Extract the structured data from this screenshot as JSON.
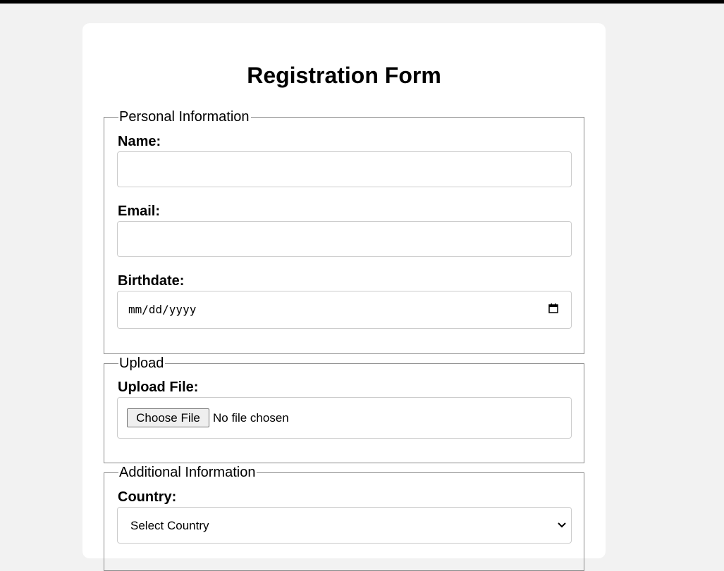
{
  "form": {
    "title": "Registration Form",
    "personal": {
      "legend": "Personal Information",
      "name_label": "Name:",
      "name_value": "",
      "email_label": "Email:",
      "email_value": "",
      "birthdate_label": "Birthdate:",
      "birthdate_placeholder": "mm/dd/yyyy"
    },
    "upload": {
      "legend": "Upload",
      "file_label": "Upload File:",
      "choose_button": "Choose File",
      "file_status": "No file chosen"
    },
    "additional": {
      "legend": "Additional Information",
      "country_label": "Country:",
      "country_selected": "Select Country"
    }
  },
  "icons": {
    "date": "calendar-icon",
    "select": "chevron-down-icon"
  },
  "colors": {
    "page_bg": "#f2f2f2",
    "card_bg": "#ffffff",
    "field_border": "#cccccc",
    "fieldset_border": "#8a8a8a"
  }
}
